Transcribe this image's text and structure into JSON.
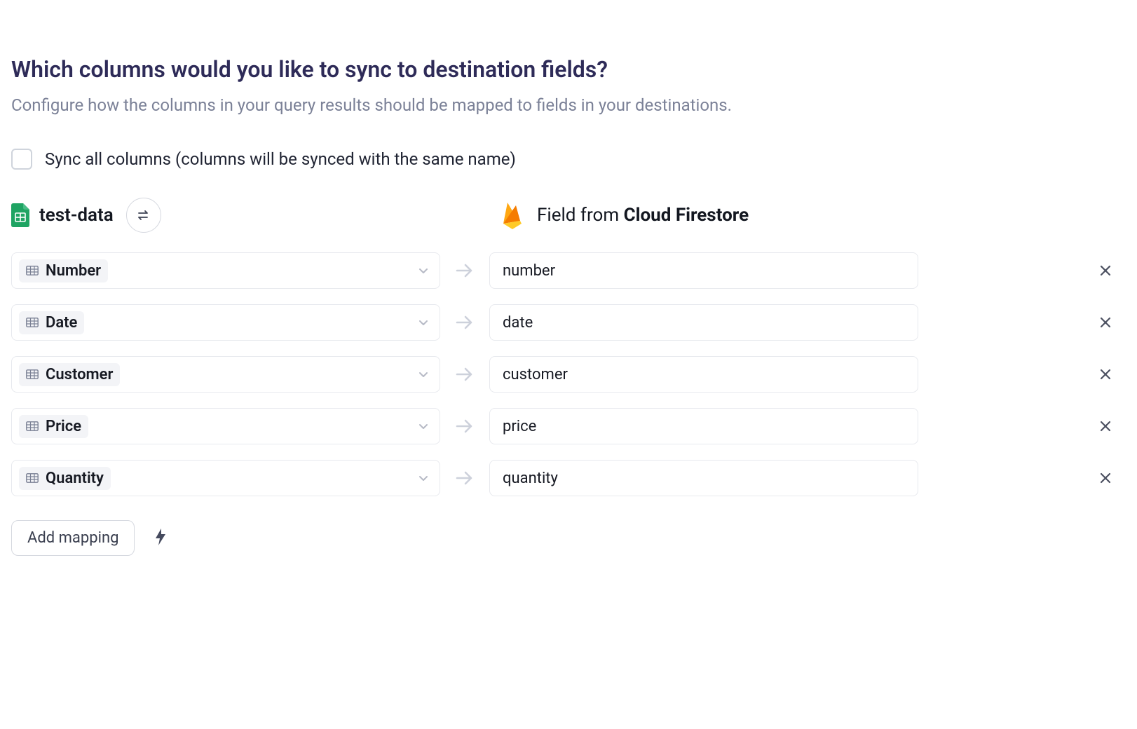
{
  "heading": "Which columns would you like to sync to destination fields?",
  "subheading": "Configure how the columns in your query results should be mapped to fields in your destinations.",
  "sync_all": {
    "checked": false,
    "label": "Sync all columns (columns will be synced with the same name)"
  },
  "source": {
    "name": "test-data"
  },
  "destination": {
    "prefix": "Field from ",
    "provider": "Cloud Firestore"
  },
  "mappings": [
    {
      "source_col": "Number",
      "dest_field": "number"
    },
    {
      "source_col": "Date",
      "dest_field": "date"
    },
    {
      "source_col": "Customer",
      "dest_field": "customer"
    },
    {
      "source_col": "Price",
      "dest_field": "price"
    },
    {
      "source_col": "Quantity",
      "dest_field": "quantity"
    }
  ],
  "footer": {
    "add_label": "Add mapping"
  }
}
